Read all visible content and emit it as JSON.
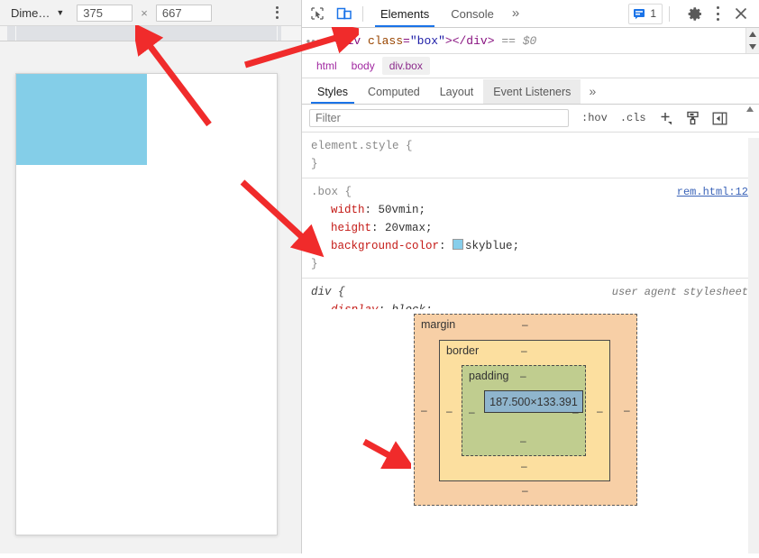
{
  "device_toolbar": {
    "device_label": "Dime…",
    "caret_icon": "chevron-down-icon",
    "width_value": "375",
    "height_value": "667",
    "multiply_symbol": "×",
    "more_icon": "vertical-dots-icon"
  },
  "viewport": {
    "box_color": "#84cee8",
    "box_name": "div.box"
  },
  "devtools_toolbar": {
    "inspect_icon": "inspect-cursor-icon",
    "device_toggle_icon": "device-toolbar-icon",
    "tabs": [
      {
        "label": "Elements",
        "active": true
      },
      {
        "label": "Console",
        "active": false
      }
    ],
    "more_tabs_icon": "»",
    "message_badge": {
      "icon": "console-message-icon",
      "count": "1",
      "color": "#1a73e8"
    },
    "settings_icon": "gear-icon",
    "menu_icon": "vertical-dots-icon",
    "close_icon": "close-icon"
  },
  "dom_strip": {
    "ellipsis": "•••",
    "code": {
      "open_lt": "<",
      "tag": "div",
      "attr_name": "class",
      "attr_eq": "=",
      "attr_value": "\"box\"",
      "open_gt": ">",
      "close": "</div>",
      "selected_marker": "== $0"
    },
    "scroll_up_icon": "scroll-up-arrow-icon",
    "scroll_down_icon": "scroll-down-arrow-icon"
  },
  "breadcrumb": {
    "items": [
      {
        "label": "html",
        "selected": false
      },
      {
        "label": "body",
        "selected": false
      },
      {
        "label": "div.box",
        "selected": true
      }
    ]
  },
  "sub_tabs": {
    "items": [
      {
        "label": "Styles",
        "active": true,
        "hover": false
      },
      {
        "label": "Computed",
        "active": false,
        "hover": false
      },
      {
        "label": "Layout",
        "active": false,
        "hover": false
      },
      {
        "label": "Event Listeners",
        "active": false,
        "hover": true
      }
    ],
    "more_icon": "»"
  },
  "filter_row": {
    "placeholder": "Filter",
    "value": "",
    "hov_label": ":hov",
    "cls_label": ".cls",
    "new_rule_icon": "plus-icon",
    "new_style_rule_icon": "stylesheet-icon",
    "toggle_sidebar_icon": "panel-collapse-icon",
    "scroll_icon": "scroll-up-arrow-icon"
  },
  "style_rules": [
    {
      "selector": "element.style",
      "origin": "",
      "origin_is_ua": false,
      "declarations": []
    },
    {
      "selector": ".box",
      "origin": "rem.html:12",
      "origin_is_ua": false,
      "declarations": [
        {
          "property": "width",
          "value": "50vmin",
          "swatch": null
        },
        {
          "property": "height",
          "value": "20vmax",
          "swatch": null
        },
        {
          "property": "background-color",
          "value": "skyblue",
          "swatch": "#87ceeb"
        }
      ]
    },
    {
      "selector": "div",
      "origin": "user agent stylesheet",
      "origin_is_ua": true,
      "declarations": [
        {
          "property": "display",
          "value": "block",
          "swatch": null
        }
      ]
    }
  ],
  "box_model": {
    "margin_label": "margin",
    "border_label": "border",
    "padding_label": "padding",
    "content_size": "187.500×133.391",
    "dash": "‒",
    "margin_values": {
      "top": "‒",
      "right": "‒",
      "bottom": "‒",
      "left": "‒"
    },
    "border_values": {
      "top": "‒",
      "right": "‒",
      "bottom": "‒",
      "left": "‒"
    },
    "padding_values": {
      "top": "‒",
      "right": "‒",
      "bottom": "‒",
      "left": "‒"
    },
    "colors": {
      "margin": "#f7cfa6",
      "border": "#fcdf9f",
      "padding": "#c0cd8f",
      "content": "#8fb5cd"
    }
  },
  "annotations": {
    "arrow_color": "#f02b2b",
    "arrows": [
      {
        "name": "arrow-to-device-width-field"
      },
      {
        "name": "arrow-to-elements-panel"
      },
      {
        "name": "arrow-to-background-color-declaration"
      },
      {
        "name": "arrow-to-content-box-size"
      }
    ]
  }
}
